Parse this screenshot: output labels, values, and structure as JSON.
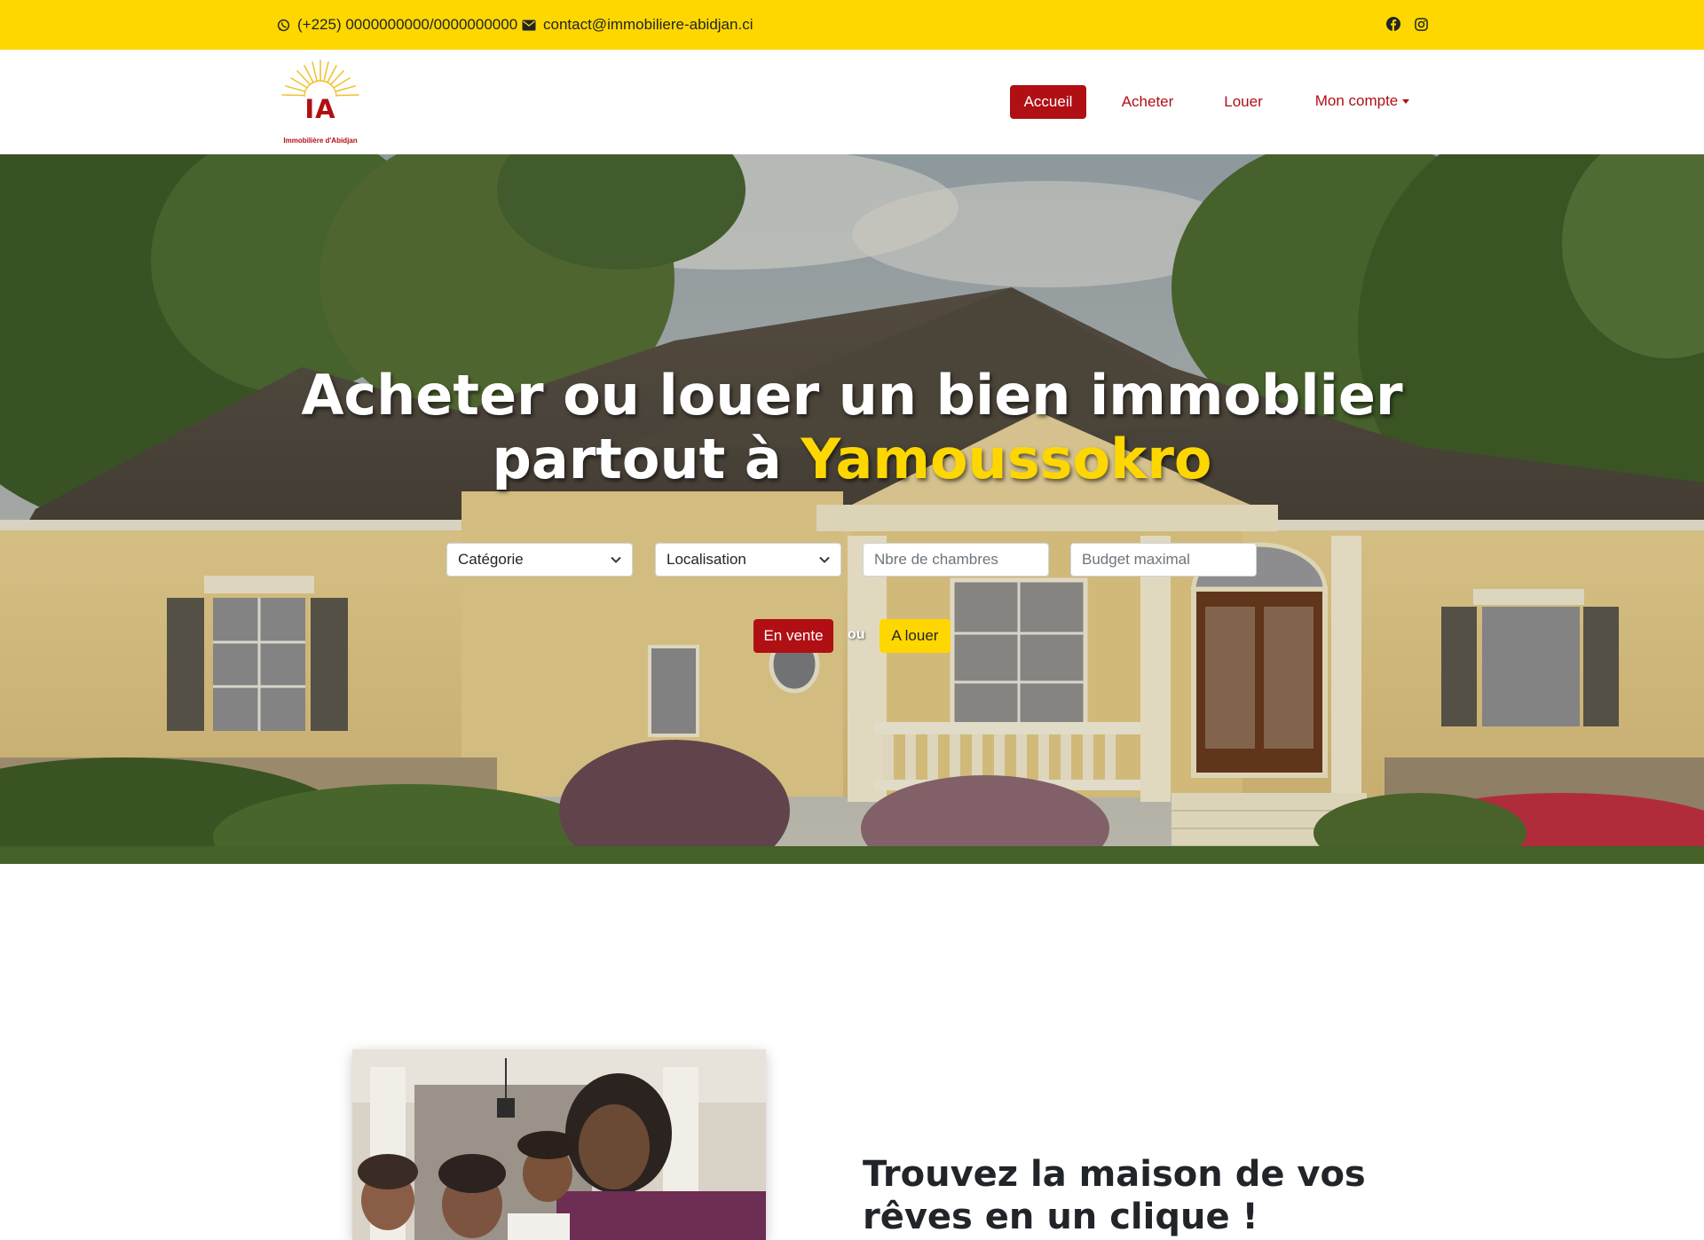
{
  "topbar": {
    "phone": "(+225) 0000000000/0000000000",
    "email": "contact@immobiliere-abidjan.ci",
    "icons": [
      "whatsapp-icon",
      "envelope-icon",
      "facebook-icon",
      "instagram-icon"
    ]
  },
  "logo": {
    "letters": "IA",
    "tagline": "Immobilière d'Abidjan"
  },
  "nav": {
    "home": "Accueil",
    "buy": "Acheter",
    "rent": "Louer",
    "account": "Mon compte"
  },
  "hero": {
    "title_line1": "Acheter ou louer un bien immoblier",
    "title_line2": "partout à",
    "title_city": "Yamoussokro",
    "search": {
      "category": "Catégorie",
      "location": "Localisation",
      "bedrooms_placeholder": "Nbre de chambres",
      "budget_placeholder": "Budget maximal"
    },
    "buttons": {
      "sale": "En vente",
      "or": "ou",
      "rent": "A louer"
    }
  },
  "intro": {
    "headline": "Trouvez la maison de vos rêves en un clique !"
  },
  "colors": {
    "primary_red": "#b00f14",
    "accent_yellow": "#ffd700",
    "text_dark": "#212529"
  }
}
